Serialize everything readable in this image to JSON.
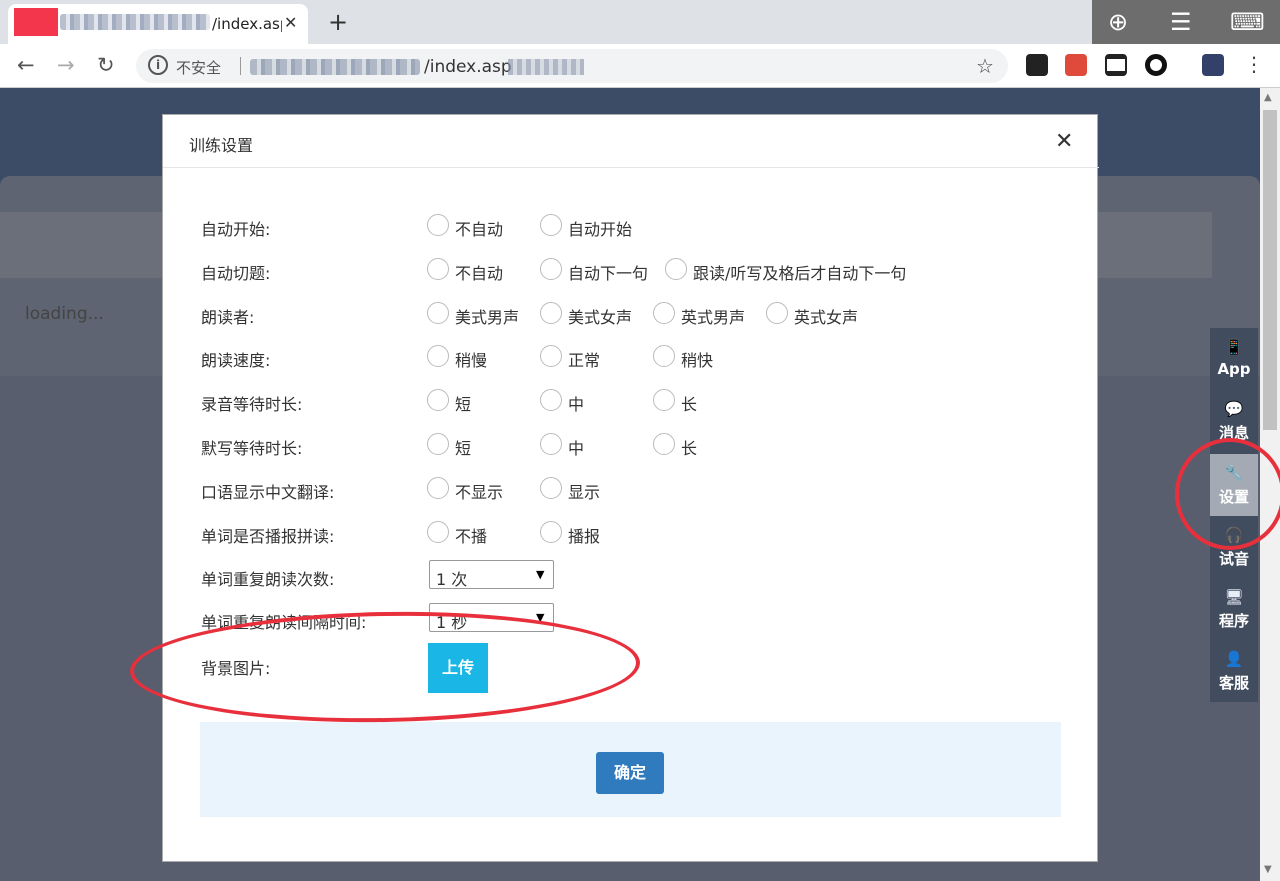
{
  "browser": {
    "tab_title": "/index.asp",
    "tab_close": "✕",
    "new_tab": "+",
    "back": "←",
    "forward": "→",
    "reload": "↻",
    "info": "i",
    "security_label": "不安全",
    "url": "/index.asp",
    "star": "☆",
    "menu": "⋮",
    "overlay_icons": [
      "zoom-in-icon",
      "hamburger-icon",
      "keyboard-icon"
    ],
    "extensions": [
      "ghost-icon",
      "todoist-icon",
      "mask-icon",
      "circle-icon",
      "pixel-avatar-icon"
    ]
  },
  "page": {
    "loading_text": "loading..."
  },
  "sidebar": {
    "items": [
      {
        "icon": "📱",
        "label": "App"
      },
      {
        "icon": "💬",
        "label": "消息"
      },
      {
        "icon": "🔧",
        "label": "设置"
      },
      {
        "icon": "🎧",
        "label": "试音"
      },
      {
        "icon": "🖥",
        "label": "程序"
      },
      {
        "icon": "👤",
        "label": "客服"
      }
    ],
    "active_index": 2
  },
  "modal": {
    "title": "训练设置",
    "close": "✕",
    "rows": [
      {
        "label": "自动开始:",
        "options": [
          "不自动",
          "自动开始"
        ]
      },
      {
        "label": "自动切题:",
        "options": [
          "不自动",
          "自动下一句",
          "跟读/听写及格后才自动下一句"
        ]
      },
      {
        "label": "朗读者:",
        "options": [
          "美式男声",
          "美式女声",
          "英式男声",
          "英式女声"
        ]
      },
      {
        "label": "朗读速度:",
        "options": [
          "稍慢",
          "正常",
          "稍快"
        ]
      },
      {
        "label": "录音等待时长:",
        "options": [
          "短",
          "中",
          "长"
        ]
      },
      {
        "label": "默写等待时长:",
        "options": [
          "短",
          "中",
          "长"
        ]
      },
      {
        "label": "口语显示中文翻译:",
        "options": [
          "不显示",
          "显示"
        ]
      },
      {
        "label": "单词是否播报拼读:",
        "options": [
          "不播",
          "播报"
        ]
      }
    ],
    "repeat_count": {
      "label": "单词重复朗读次数:",
      "value": "1 次",
      "arrow": "▼"
    },
    "repeat_interval": {
      "label": "单词重复朗读间隔时间:",
      "value": "1 秒",
      "arrow": "▼"
    },
    "background": {
      "label": "背景图片:",
      "upload": "上传"
    },
    "confirm": "确定"
  },
  "colors": {
    "annotation": "#e8303d",
    "primary": "#2f7bbd",
    "upload": "#1ab6e5"
  }
}
